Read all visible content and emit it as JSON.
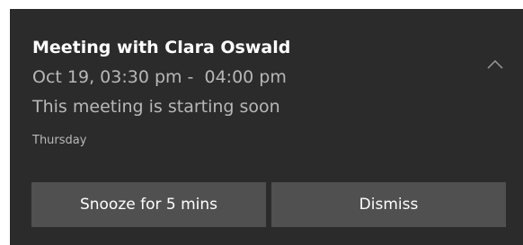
{
  "notification": {
    "title": "Meeting with Clara Oswald",
    "time": "Oct 19, 03:30 pm -  04:00 pm",
    "message": "This meeting is starting soon",
    "attribution": "Thursday",
    "collapse_icon": "chevron-up-icon"
  },
  "actions": {
    "snooze_label": "Snooze for 5 mins",
    "dismiss_label": "Dismiss"
  },
  "colors": {
    "background": "#2b2b2b",
    "button": "#505050",
    "primary_text": "#ffffff",
    "secondary_text": "#b8b8b8"
  }
}
